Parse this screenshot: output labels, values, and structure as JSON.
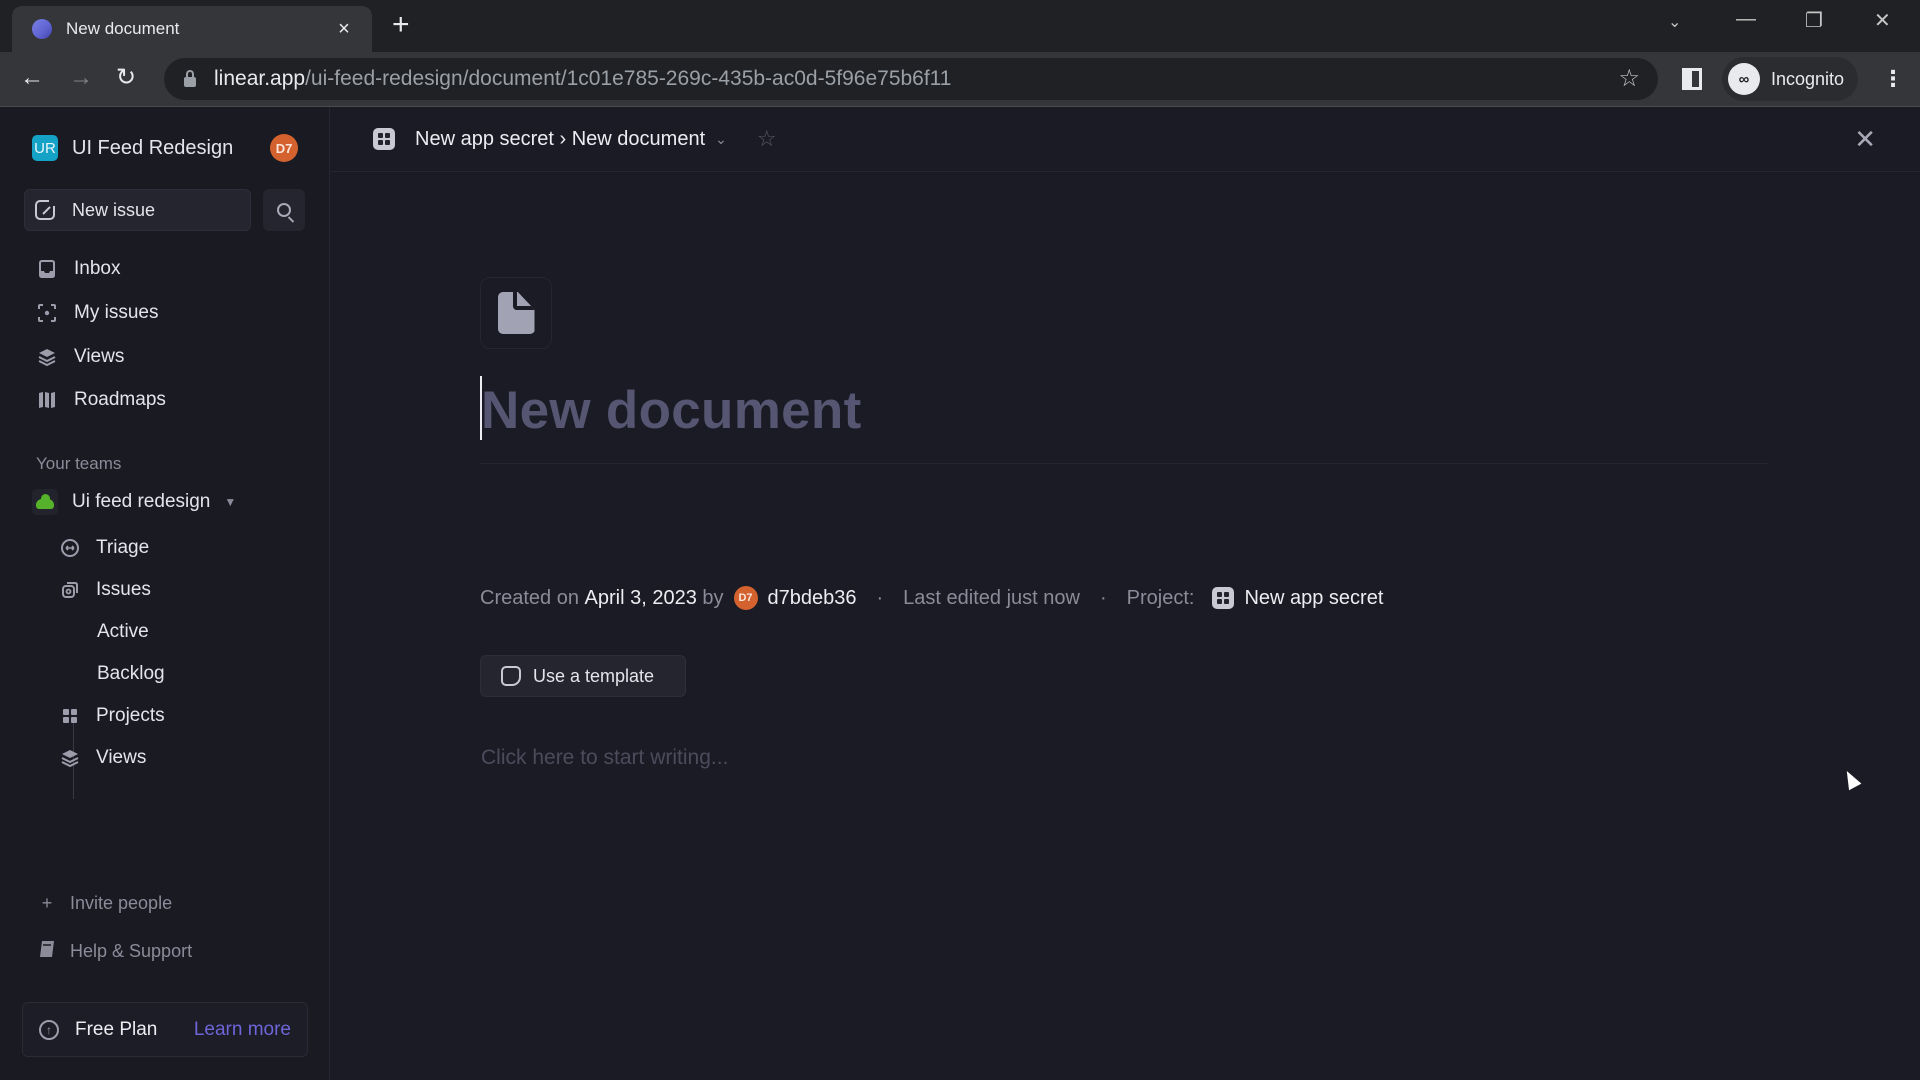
{
  "browser": {
    "tab_title": "New document",
    "tab_close": "×",
    "new_tab": "+",
    "url_host": "linear.app",
    "url_path": "/ui-feed-redesign/document/1c01e785-269c-435b-ac0d-5f96e75b6f11",
    "profile_label": "Incognito",
    "icons": {
      "back": "←",
      "forward": "→",
      "reload": "↻",
      "star": "☆",
      "menu": "⋮",
      "tab_search": "⌄",
      "minimize": "—",
      "restore": "❐",
      "close": "✕"
    }
  },
  "sidebar": {
    "workspace_initials": "UR",
    "workspace_name": "UI Feed Redesign",
    "user_initials": "D7",
    "new_issue_label": "New issue",
    "nav": [
      {
        "label": "Inbox",
        "icon": "inbox-icon"
      },
      {
        "label": "My issues",
        "icon": "my-issues-icon"
      },
      {
        "label": "Views",
        "icon": "views-icon"
      },
      {
        "label": "Roadmaps",
        "icon": "roadmaps-icon"
      }
    ],
    "teams_section_label": "Your teams",
    "team": {
      "name": "Ui feed redesign",
      "caret": "▼",
      "items": [
        {
          "label": "Triage"
        },
        {
          "label": "Issues"
        },
        {
          "label": "Active"
        },
        {
          "label": "Backlog"
        },
        {
          "label": "Projects"
        },
        {
          "label": "Views"
        }
      ]
    },
    "footer": {
      "invite_label": "Invite people",
      "help_label": "Help & Support",
      "plan_label": "Free Plan",
      "plan_link": "Learn more"
    }
  },
  "header": {
    "breadcrumb": "New app secret › New document",
    "star": "☆",
    "close": "✕"
  },
  "document": {
    "title_placeholder": "New document",
    "meta": {
      "created_prefix": "Created on",
      "created_date": "April 3, 2023",
      "by": "by",
      "author_initials": "D7",
      "author": "d7bdeb36",
      "separator": "·",
      "last_edited": "Last edited just now",
      "project_label": "Project:",
      "project_name": "New app secret"
    },
    "template_button": "Use a template",
    "body_placeholder": "Click here to start writing..."
  },
  "colors": {
    "accent_link": "#6d65d8",
    "workspace_logo": "#14a3c6",
    "avatar": "#d3622f",
    "team_icon": "#55b22a",
    "background": "#1b1b25"
  }
}
